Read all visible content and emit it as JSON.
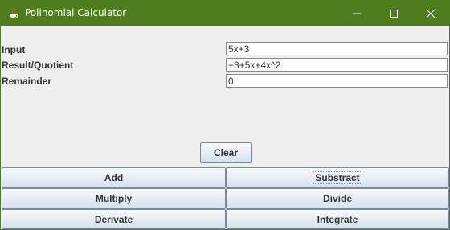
{
  "window": {
    "title": "Polinomial Calculator",
    "colors": {
      "titlebar": "#4e7c1e",
      "background": "#eeeeee"
    }
  },
  "form": {
    "input": {
      "label": "Input",
      "value": "5x+3"
    },
    "result": {
      "label": "Result/Quotient",
      "value": "+3+5x+4x^2"
    },
    "remainder": {
      "label": "Remainder",
      "value": "0"
    }
  },
  "buttons": {
    "clear": "Clear",
    "add": "Add",
    "substract": "Substract",
    "multiply": "Multiply",
    "divide": "Divide",
    "derivate": "Derivate",
    "integrate": "Integrate"
  },
  "icons": [
    "java-app-icon",
    "minimize-icon",
    "maximize-icon",
    "close-icon"
  ]
}
